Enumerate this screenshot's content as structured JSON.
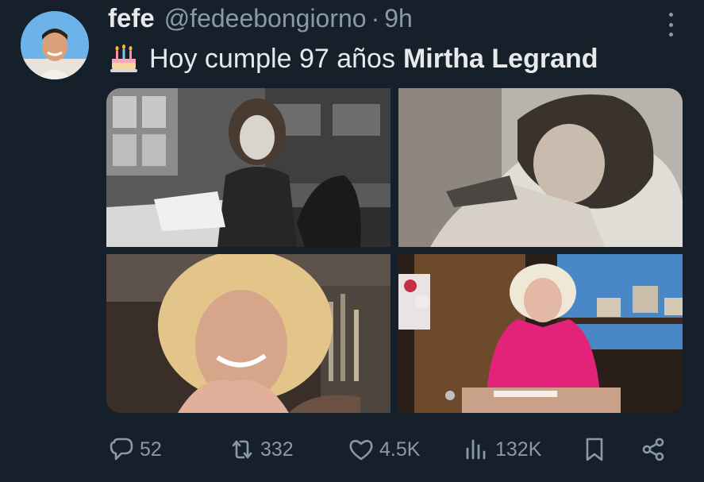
{
  "tweet": {
    "display_name": "fefe",
    "handle": "@fedeebongiorno",
    "separator": "·",
    "time": "9h",
    "text_prefix": "Hoy cumple 97 años",
    "text_bold": "Mirtha Legrand",
    "emoji": "birthday-cake-icon"
  },
  "images": [
    {
      "name": "photo-1",
      "style": "black-and-white"
    },
    {
      "name": "photo-2",
      "style": "black-and-white"
    },
    {
      "name": "photo-3",
      "style": "color"
    },
    {
      "name": "photo-4",
      "style": "color"
    }
  ],
  "actions": {
    "replies": "52",
    "retweets": "332",
    "likes": "4.5K",
    "views": "132K"
  },
  "colors": {
    "background": "#15202b",
    "text": "#e7e9ea",
    "muted": "#8b98a5"
  }
}
